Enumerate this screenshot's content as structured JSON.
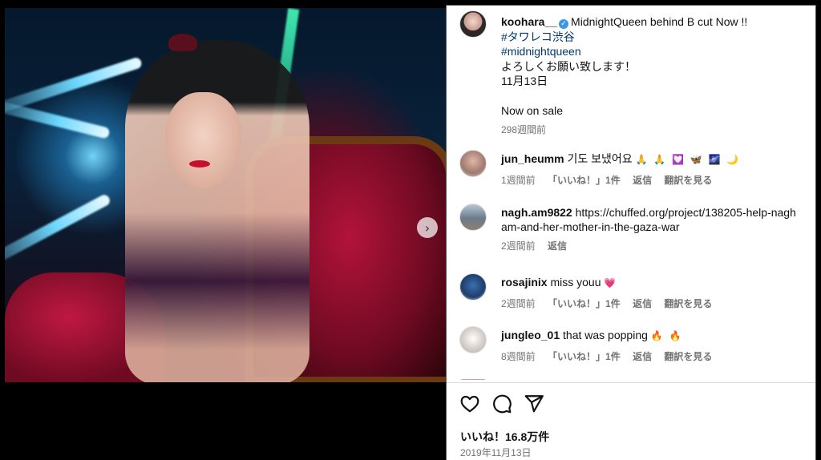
{
  "post": {
    "author": "koohara__",
    "verified": true,
    "caption_head": "MidnightQueen behind B cut Now !!",
    "hashtags": [
      "#タワレコ渋谷",
      "#midnightqueen"
    ],
    "caption_lines": [
      "よろしくお願い致します！",
      "11月13日",
      "",
      "Now on sale"
    ],
    "posted_ago": "298週間前"
  },
  "comments": [
    {
      "user": "jun_heumm",
      "text": "기도 보냈어요",
      "emoji": "🙏 🙏 💟 🦋 🌌 🌙",
      "time": "1週間前",
      "likes": "「いいね！」1件",
      "reply": "返信",
      "translate": "翻訳を見る"
    },
    {
      "user": "nagh.am9822",
      "text": "https://chuffed.org/project/138205-help-nagham-and-her-mother-in-the-gaza-war",
      "emoji": "",
      "time": "2週間前",
      "likes": "",
      "reply": "返信",
      "translate": ""
    },
    {
      "user": "rosajinix",
      "text": "miss youu",
      "emoji": "💗",
      "time": "2週間前",
      "likes": "「いいね！」1件",
      "reply": "返信",
      "translate": "翻訳を見る"
    },
    {
      "user": "jungleo_01",
      "text": "that was popping",
      "emoji": "🔥 🔥",
      "time": "8週間前",
      "likes": "「いいね！」1件",
      "reply": "返信",
      "translate": "翻訳を見る"
    }
  ],
  "footer": {
    "likes_count": "いいね！16.8万件",
    "date": "2019年11月13日",
    "icons": [
      "heart-icon",
      "comment-icon",
      "share-icon"
    ]
  },
  "media": {
    "next_icon": "chevron-right-icon",
    "next_glyph": "›"
  },
  "colors": {
    "link": "#00376b",
    "verified": "#3897f0",
    "muted": "#737373"
  }
}
